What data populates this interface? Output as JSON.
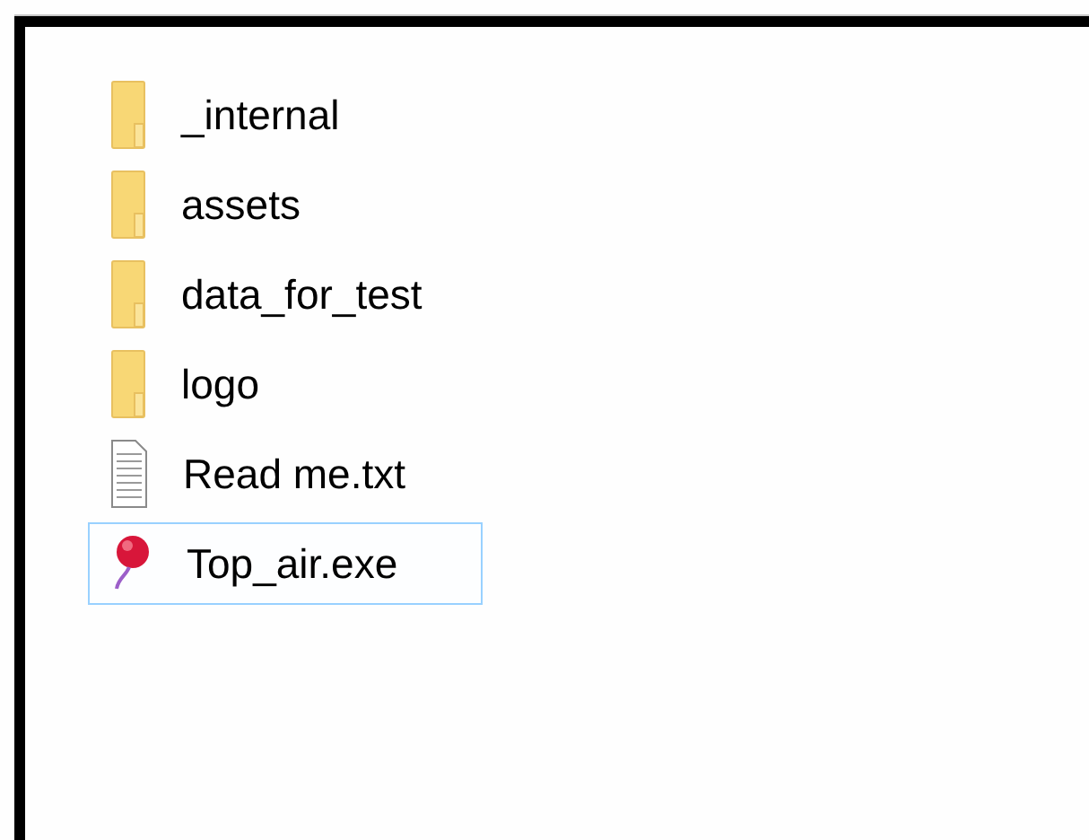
{
  "files": [
    {
      "name": "_internal",
      "kind": "folder",
      "selected": false
    },
    {
      "name": "assets",
      "kind": "folder",
      "selected": false
    },
    {
      "name": "data_for_test",
      "kind": "folder",
      "selected": false
    },
    {
      "name": "logo",
      "kind": "folder",
      "selected": false
    },
    {
      "name": "Read me.txt",
      "kind": "text",
      "selected": false
    },
    {
      "name": "Top_air.exe",
      "kind": "app",
      "selected": true
    }
  ]
}
